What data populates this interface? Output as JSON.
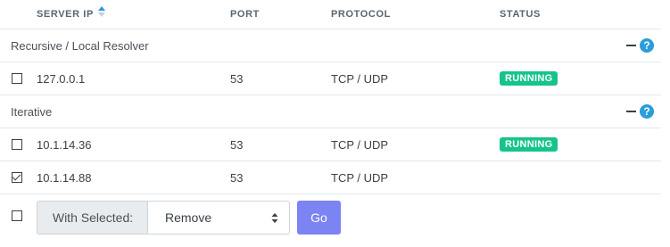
{
  "columns": {
    "server_ip": "SERVER IP",
    "port": "PORT",
    "protocol": "PROTOCOL",
    "status": "STATUS"
  },
  "groups": [
    {
      "title": "Recursive / Local Resolver",
      "servers": [
        {
          "ip": "127.0.0.1",
          "port": "53",
          "protocol": "TCP / UDP",
          "status": "RUNNING",
          "checked": false
        }
      ]
    },
    {
      "title": "Iterative",
      "servers": [
        {
          "ip": "10.1.14.36",
          "port": "53",
          "protocol": "TCP / UDP",
          "status": "RUNNING",
          "checked": false
        },
        {
          "ip": "10.1.14.88",
          "port": "53",
          "protocol": "TCP / UDP",
          "status": "",
          "checked": true
        }
      ]
    }
  ],
  "bulk": {
    "label": "With Selected:",
    "action": "Remove",
    "go": "Go"
  },
  "colors": {
    "running": "#17c38c",
    "go_button": "#7c83f3",
    "help": "#2b9dd8"
  },
  "icons": {
    "sort": "sort-asc-icon",
    "collapse": "minus-icon",
    "help": "question-circle-icon",
    "caret": "select-caret-icon"
  }
}
